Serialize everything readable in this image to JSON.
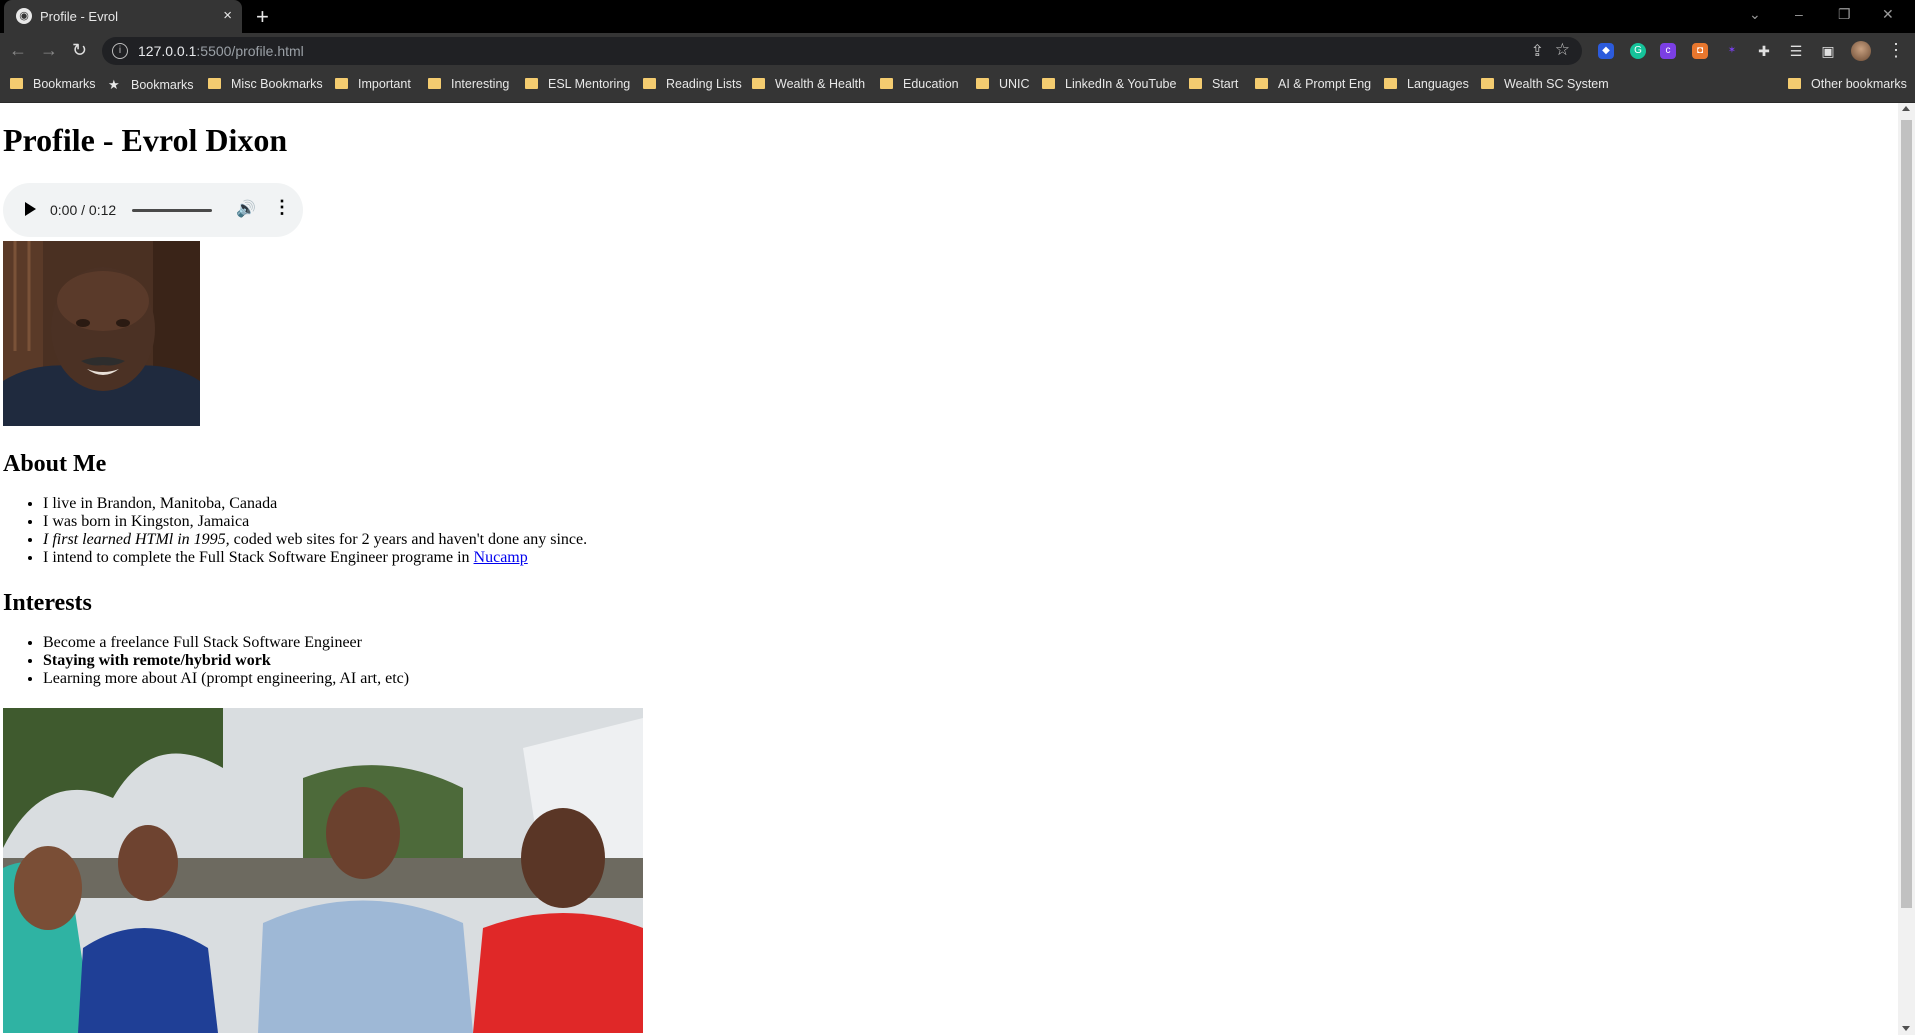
{
  "tab": {
    "title": "Profile - Evrol",
    "close_glyph": "×",
    "new_tab_glyph": "+"
  },
  "window_controls": [
    "⌄",
    "–",
    "❐",
    "✕"
  ],
  "address_bar": {
    "host": "127.0.0.1",
    "path": ":5500/profile.html"
  },
  "bookmarks": [
    {
      "label": "Bookmarks",
      "icon": "folder-icon"
    },
    {
      "label": "Bookmarks",
      "icon": "star-icon"
    },
    {
      "label": "Misc Bookmarks",
      "icon": "folder-icon"
    },
    {
      "label": "Important",
      "icon": "folder-icon"
    },
    {
      "label": "Interesting",
      "icon": "folder-icon"
    },
    {
      "label": "ESL Mentoring",
      "icon": "folder-icon"
    },
    {
      "label": "Reading Lists",
      "icon": "folder-icon"
    },
    {
      "label": "Wealth & Health",
      "icon": "folder-icon"
    },
    {
      "label": "Education",
      "icon": "folder-icon"
    },
    {
      "label": "UNIC",
      "icon": "folder-icon"
    },
    {
      "label": "LinkedIn & YouTube",
      "icon": "folder-icon"
    },
    {
      "label": "Start",
      "icon": "folder-icon"
    },
    {
      "label": "AI & Prompt Eng",
      "icon": "folder-icon"
    },
    {
      "label": "Languages",
      "icon": "folder-icon"
    },
    {
      "label": "Wealth SC System",
      "icon": "folder-icon"
    },
    {
      "label": "Other bookmarks",
      "icon": "folder-icon"
    }
  ],
  "page": {
    "heading": "Profile - Evrol Dixon",
    "audio": {
      "time": "0:00 / 0:12"
    },
    "about_heading": "About Me",
    "about_items": {
      "item1": "I live in Brandon, Manitoba, Canada",
      "item2": "I was born in Kingston, Jamaica",
      "item3_italic": "I first learned HTMl in 1995,",
      "item3_rest": " coded web sites for 2 years and haven't done any since.",
      "item4_text": "I intend to complete the Full Stack Software Engineer programe in ",
      "item4_link": "Nucamp"
    },
    "interests_heading": "Interests",
    "interests_items": {
      "item1": "Become a freelance Full Stack Software Engineer",
      "item2_bold": "Staying with remote/hybrid work",
      "item3": "Learning more about AI (prompt engineering, AI art, etc)"
    }
  },
  "colors": {
    "chrome_dark": "#000000",
    "toolbar": "#353535",
    "omnibox": "#202124",
    "folder": "#f4cc70",
    "link": "#0000ee"
  }
}
